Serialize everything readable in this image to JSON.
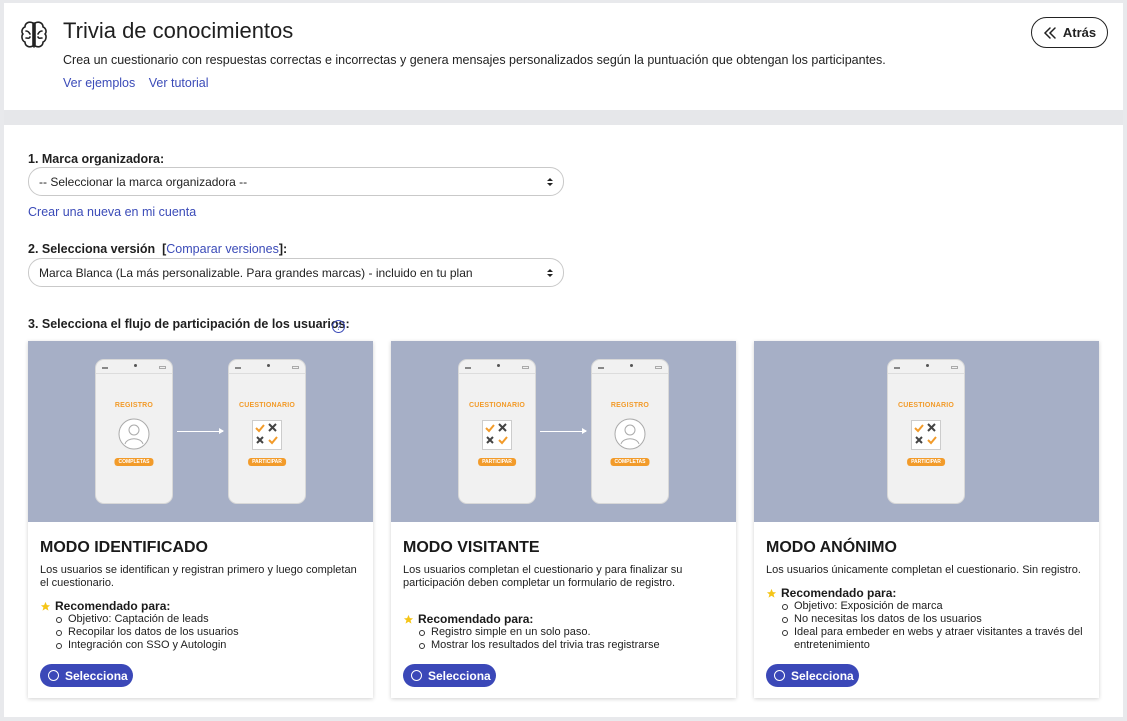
{
  "header": {
    "title": "Trivia de conocimientos",
    "subtitle": "Crea un cuestionario con respuestas correctas e incorrectas y genera mensajes personalizados según la puntuación que obtengan los participantes.",
    "link_examples": "Ver ejemplos",
    "link_tutorial": "Ver tutorial",
    "back_label": "Atrás"
  },
  "step1": {
    "label": "1. Marca organizadora:",
    "select_value": "-- Seleccionar la marca organizadora --",
    "create_link": "Crear una nueva en mi cuenta"
  },
  "step2": {
    "label": "2. Selecciona versión",
    "compare_link": "Comparar versiones",
    "select_value": "Marca Blanca (La más personalizable. Para grandes marcas) - incluido en tu plan"
  },
  "step3": {
    "label": "3. Selecciona el flujo de participación de los usuarios:",
    "help_glyph": "?"
  },
  "phone_labels": {
    "registro": "REGISTRO",
    "cuestionario": "CUESTIONARIO",
    "completas": "COMPLETAS",
    "participar": "PARTICIPAR"
  },
  "cards": [
    {
      "title": "MODO IDENTIFICADO",
      "description": "Los usuarios se identifican y registran primero y luego completan el cuestionario.",
      "recommended": "Recomendado para:",
      "items": [
        "Objetivo: Captación de leads",
        "Recopilar los datos de los usuarios",
        "Integración con SSO y Autologin"
      ],
      "button": "Selecciona"
    },
    {
      "title": "MODO VISITANTE",
      "description": "Los usuarios completan el cuestionario y para finalizar su participación deben completar un formulario de registro.",
      "recommended": "Recomendado para:",
      "items": [
        "Registro simple en un solo paso.",
        "Mostrar los resultados del trivia tras registrarse"
      ],
      "button": "Selecciona"
    },
    {
      "title": "MODO ANÓNIMO",
      "description": "Los usuarios únicamente completan el cuestionario. Sin registro.",
      "recommended": "Recomendado para:",
      "items": [
        "Objetivo: Exposición de marca",
        "No necesitas los datos de los usuarios",
        "Ideal para embeder en webs y atraer visitantes a través del entretenimiento"
      ],
      "button": "Selecciona"
    }
  ],
  "colors": {
    "accent": "#3b48b8",
    "link": "#3b4bb8",
    "illustration_bg": "#a6afc6",
    "orange": "#f29b2a"
  }
}
